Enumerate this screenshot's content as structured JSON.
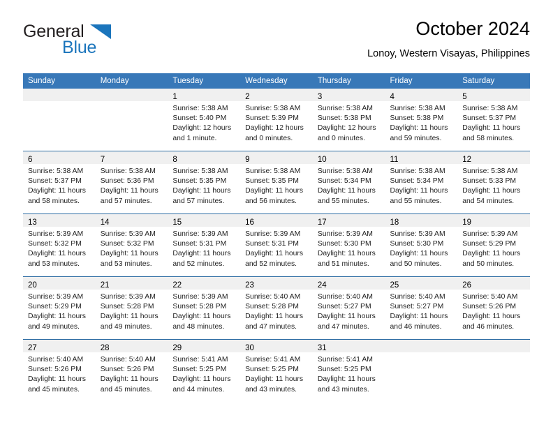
{
  "brand": {
    "name_part1": "General",
    "name_part2": "Blue",
    "color_dark": "#231f20",
    "color_blue": "#1b75bc"
  },
  "header": {
    "title": "October 2024",
    "subtitle": "Lonoy, Western Visayas, Philippines"
  },
  "theme": {
    "header_bg": "#3878b8",
    "row_border": "#2e6da4",
    "date_band_bg": "#f0f0f0"
  },
  "weekdays": [
    "Sunday",
    "Monday",
    "Tuesday",
    "Wednesday",
    "Thursday",
    "Friday",
    "Saturday"
  ],
  "weeks": [
    [
      {
        "day": "",
        "empty": true
      },
      {
        "day": "",
        "empty": true
      },
      {
        "day": "1",
        "sunrise": "Sunrise: 5:38 AM",
        "sunset": "Sunset: 5:40 PM",
        "daylight": "Daylight: 12 hours and 1 minute."
      },
      {
        "day": "2",
        "sunrise": "Sunrise: 5:38 AM",
        "sunset": "Sunset: 5:39 PM",
        "daylight": "Daylight: 12 hours and 0 minutes."
      },
      {
        "day": "3",
        "sunrise": "Sunrise: 5:38 AM",
        "sunset": "Sunset: 5:38 PM",
        "daylight": "Daylight: 12 hours and 0 minutes."
      },
      {
        "day": "4",
        "sunrise": "Sunrise: 5:38 AM",
        "sunset": "Sunset: 5:38 PM",
        "daylight": "Daylight: 11 hours and 59 minutes."
      },
      {
        "day": "5",
        "sunrise": "Sunrise: 5:38 AM",
        "sunset": "Sunset: 5:37 PM",
        "daylight": "Daylight: 11 hours and 58 minutes."
      }
    ],
    [
      {
        "day": "6",
        "sunrise": "Sunrise: 5:38 AM",
        "sunset": "Sunset: 5:37 PM",
        "daylight": "Daylight: 11 hours and 58 minutes."
      },
      {
        "day": "7",
        "sunrise": "Sunrise: 5:38 AM",
        "sunset": "Sunset: 5:36 PM",
        "daylight": "Daylight: 11 hours and 57 minutes."
      },
      {
        "day": "8",
        "sunrise": "Sunrise: 5:38 AM",
        "sunset": "Sunset: 5:35 PM",
        "daylight": "Daylight: 11 hours and 57 minutes."
      },
      {
        "day": "9",
        "sunrise": "Sunrise: 5:38 AM",
        "sunset": "Sunset: 5:35 PM",
        "daylight": "Daylight: 11 hours and 56 minutes."
      },
      {
        "day": "10",
        "sunrise": "Sunrise: 5:38 AM",
        "sunset": "Sunset: 5:34 PM",
        "daylight": "Daylight: 11 hours and 55 minutes."
      },
      {
        "day": "11",
        "sunrise": "Sunrise: 5:38 AM",
        "sunset": "Sunset: 5:34 PM",
        "daylight": "Daylight: 11 hours and 55 minutes."
      },
      {
        "day": "12",
        "sunrise": "Sunrise: 5:38 AM",
        "sunset": "Sunset: 5:33 PM",
        "daylight": "Daylight: 11 hours and 54 minutes."
      }
    ],
    [
      {
        "day": "13",
        "sunrise": "Sunrise: 5:39 AM",
        "sunset": "Sunset: 5:32 PM",
        "daylight": "Daylight: 11 hours and 53 minutes."
      },
      {
        "day": "14",
        "sunrise": "Sunrise: 5:39 AM",
        "sunset": "Sunset: 5:32 PM",
        "daylight": "Daylight: 11 hours and 53 minutes."
      },
      {
        "day": "15",
        "sunrise": "Sunrise: 5:39 AM",
        "sunset": "Sunset: 5:31 PM",
        "daylight": "Daylight: 11 hours and 52 minutes."
      },
      {
        "day": "16",
        "sunrise": "Sunrise: 5:39 AM",
        "sunset": "Sunset: 5:31 PM",
        "daylight": "Daylight: 11 hours and 52 minutes."
      },
      {
        "day": "17",
        "sunrise": "Sunrise: 5:39 AM",
        "sunset": "Sunset: 5:30 PM",
        "daylight": "Daylight: 11 hours and 51 minutes."
      },
      {
        "day": "18",
        "sunrise": "Sunrise: 5:39 AM",
        "sunset": "Sunset: 5:30 PM",
        "daylight": "Daylight: 11 hours and 50 minutes."
      },
      {
        "day": "19",
        "sunrise": "Sunrise: 5:39 AM",
        "sunset": "Sunset: 5:29 PM",
        "daylight": "Daylight: 11 hours and 50 minutes."
      }
    ],
    [
      {
        "day": "20",
        "sunrise": "Sunrise: 5:39 AM",
        "sunset": "Sunset: 5:29 PM",
        "daylight": "Daylight: 11 hours and 49 minutes."
      },
      {
        "day": "21",
        "sunrise": "Sunrise: 5:39 AM",
        "sunset": "Sunset: 5:28 PM",
        "daylight": "Daylight: 11 hours and 49 minutes."
      },
      {
        "day": "22",
        "sunrise": "Sunrise: 5:39 AM",
        "sunset": "Sunset: 5:28 PM",
        "daylight": "Daylight: 11 hours and 48 minutes."
      },
      {
        "day": "23",
        "sunrise": "Sunrise: 5:40 AM",
        "sunset": "Sunset: 5:28 PM",
        "daylight": "Daylight: 11 hours and 47 minutes."
      },
      {
        "day": "24",
        "sunrise": "Sunrise: 5:40 AM",
        "sunset": "Sunset: 5:27 PM",
        "daylight": "Daylight: 11 hours and 47 minutes."
      },
      {
        "day": "25",
        "sunrise": "Sunrise: 5:40 AM",
        "sunset": "Sunset: 5:27 PM",
        "daylight": "Daylight: 11 hours and 46 minutes."
      },
      {
        "day": "26",
        "sunrise": "Sunrise: 5:40 AM",
        "sunset": "Sunset: 5:26 PM",
        "daylight": "Daylight: 11 hours and 46 minutes."
      }
    ],
    [
      {
        "day": "27",
        "sunrise": "Sunrise: 5:40 AM",
        "sunset": "Sunset: 5:26 PM",
        "daylight": "Daylight: 11 hours and 45 minutes."
      },
      {
        "day": "28",
        "sunrise": "Sunrise: 5:40 AM",
        "sunset": "Sunset: 5:26 PM",
        "daylight": "Daylight: 11 hours and 45 minutes."
      },
      {
        "day": "29",
        "sunrise": "Sunrise: 5:41 AM",
        "sunset": "Sunset: 5:25 PM",
        "daylight": "Daylight: 11 hours and 44 minutes."
      },
      {
        "day": "30",
        "sunrise": "Sunrise: 5:41 AM",
        "sunset": "Sunset: 5:25 PM",
        "daylight": "Daylight: 11 hours and 43 minutes."
      },
      {
        "day": "31",
        "sunrise": "Sunrise: 5:41 AM",
        "sunset": "Sunset: 5:25 PM",
        "daylight": "Daylight: 11 hours and 43 minutes."
      },
      {
        "day": "",
        "empty": true
      },
      {
        "day": "",
        "empty": true
      }
    ]
  ]
}
